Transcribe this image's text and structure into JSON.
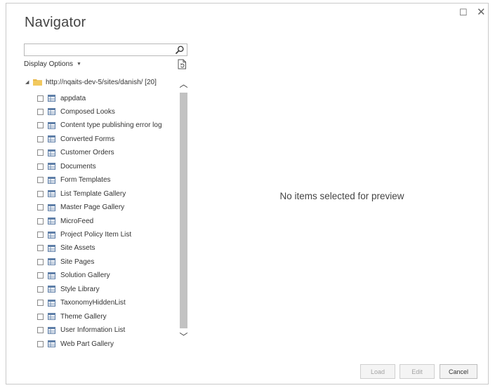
{
  "window": {
    "title": "Navigator",
    "maximize_glyph": "☐",
    "close_glyph": "✕"
  },
  "search": {
    "value": "",
    "placeholder": "",
    "icon": "search-icon"
  },
  "display_options": {
    "label": "Display Options",
    "caret": "▼",
    "preview_icon": "document-refresh-icon"
  },
  "tree": {
    "root": {
      "expand_glyph": "◢",
      "label": "http://nqaits-dev-5/sites/danish/ [20]",
      "icon": "folder-icon"
    },
    "items": [
      {
        "label": "appdata"
      },
      {
        "label": "Composed Looks"
      },
      {
        "label": "Content type publishing error log"
      },
      {
        "label": "Converted Forms"
      },
      {
        "label": "Customer Orders"
      },
      {
        "label": "Documents"
      },
      {
        "label": "Form Templates"
      },
      {
        "label": "List Template Gallery"
      },
      {
        "label": "Master Page Gallery"
      },
      {
        "label": "MicroFeed"
      },
      {
        "label": "Project Policy Item List"
      },
      {
        "label": "Site Assets"
      },
      {
        "label": "Site Pages"
      },
      {
        "label": "Solution Gallery"
      },
      {
        "label": "Style Library"
      },
      {
        "label": "TaxonomyHiddenList"
      },
      {
        "label": "Theme Gallery"
      },
      {
        "label": "User Information List"
      },
      {
        "label": "Web Part Gallery"
      }
    ]
  },
  "scrollbar": {
    "up_glyph": "︿",
    "down_glyph": "﹀"
  },
  "preview": {
    "message": "No items selected for preview"
  },
  "buttons": {
    "load": "Load",
    "edit": "Edit",
    "cancel": "Cancel"
  },
  "colors": {
    "folder": "#e8b84a",
    "table_icon": "#5f7fa8",
    "scroll_thumb": "#c2c2c2"
  }
}
